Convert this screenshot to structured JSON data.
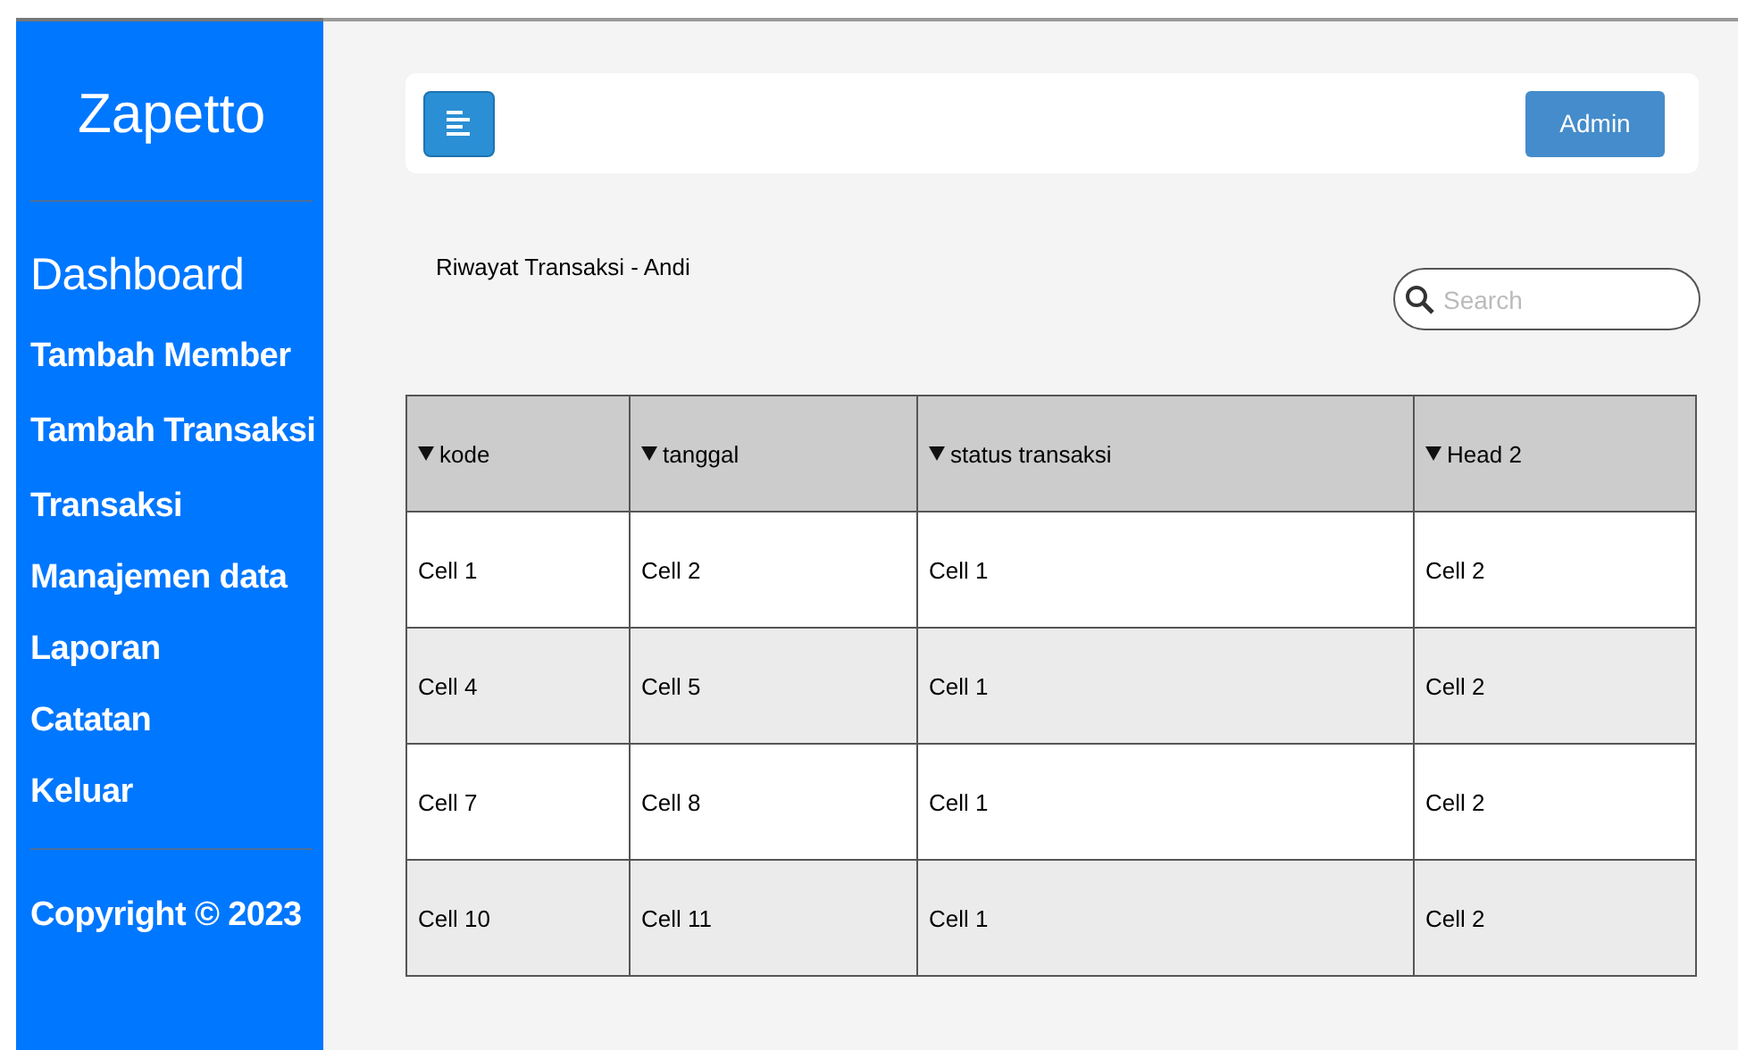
{
  "sidebar": {
    "brand": "Zapetto",
    "items": [
      {
        "label": "Dashboard",
        "selected": true
      },
      {
        "label": "Tambah Member",
        "selected": false
      },
      {
        "label": "Tambah Transaksi",
        "selected": false
      },
      {
        "label": "Transaksi",
        "selected": false
      },
      {
        "label": "Manajemen data",
        "selected": false
      },
      {
        "label": "Laporan",
        "selected": false
      },
      {
        "label": "Catatan",
        "selected": false
      },
      {
        "label": "Keluar",
        "selected": false
      }
    ],
    "footer": "Copyright © 2023"
  },
  "topbar": {
    "user_button": "Admin"
  },
  "page_title": "Riwayat Transaksi - Andi",
  "search": {
    "placeholder": "Search"
  },
  "table": {
    "columns": [
      "kode",
      "tanggal",
      "status transaksi",
      "Head 2"
    ],
    "rows": [
      [
        "Cell 1",
        "Cell 2",
        "Cell 1",
        "Cell 2"
      ],
      [
        "Cell 4",
        "Cell 5",
        "Cell 1",
        "Cell 2"
      ],
      [
        "Cell 7",
        "Cell 8",
        "Cell 1",
        "Cell 2"
      ],
      [
        "Cell 10",
        "Cell 11",
        "Cell 1",
        "Cell 2"
      ]
    ]
  }
}
